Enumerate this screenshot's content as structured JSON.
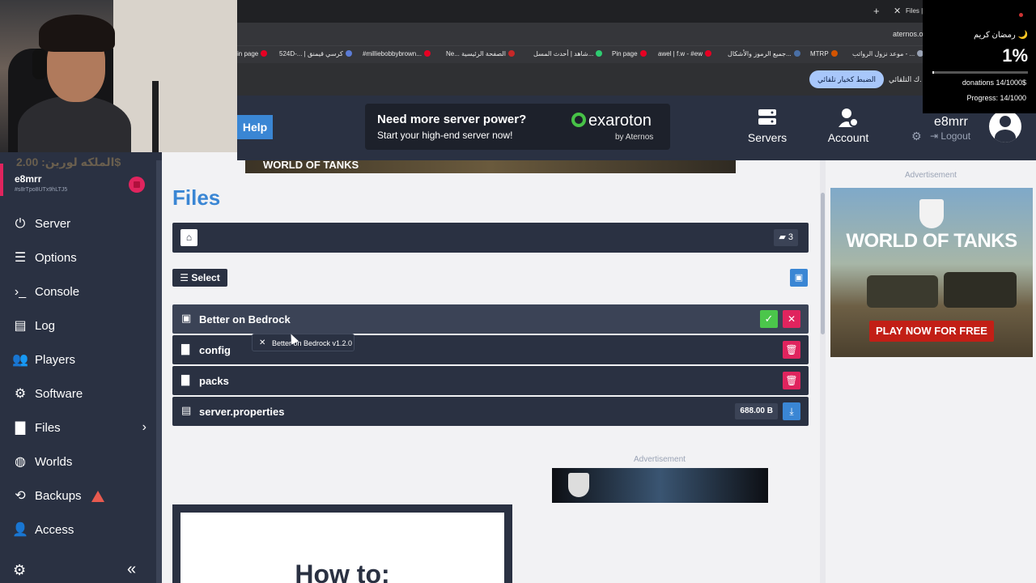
{
  "browser": {
    "tab_title": "Files |",
    "new_tab": "+",
    "close_tab": "✕",
    "url": "aternos.o",
    "bookmarks": [
      "in page",
      "524D-... | كرسي قيمنق",
      "#milliebobbybrown...",
      "Ne... الصفحة الرئيسية",
      "شاهد | أحدث المسل...",
      "Pin page",
      "awel | f.w - #ew",
      "جميع الرموز والأشكال...",
      "MTRP",
      "موعد نزول الرواتب - ..."
    ],
    "autoset_button": "الضبط كخيار تلقائي",
    "autoset_text": "ك التلقائي."
  },
  "overlay": {
    "greeting": "رمضان كريم 🌙",
    "percent": "1%",
    "progress_fraction": 0.014,
    "donations": "donations 14/1000$",
    "progress": "Progress: 14/1000"
  },
  "header": {
    "help": "Help",
    "promo_title": "Need more server power?",
    "promo_sub": "Start your high-end server now!",
    "promo_brand": "exaroton",
    "promo_brand_sub": "by Aternos",
    "nav_servers": "Servers",
    "nav_account": "Account",
    "username": "e8mrr",
    "logout": "Logout"
  },
  "sidebar": {
    "price_text": "الملكه لورين: 2.00$",
    "server_name": "e8mrr",
    "server_id": "#s8rTpo8UTx9hLTJ5",
    "items": [
      {
        "label": "Server",
        "icon": "⏻"
      },
      {
        "label": "Options",
        "icon": "☰"
      },
      {
        "label": "Console",
        "icon": "›_"
      },
      {
        "label": "Log",
        "icon": "▤"
      },
      {
        "label": "Players",
        "icon": "👥"
      },
      {
        "label": "Software",
        "icon": "⚙"
      },
      {
        "label": "Files",
        "icon": "▇"
      },
      {
        "label": "Worlds",
        "icon": "◍"
      },
      {
        "label": "Backups",
        "icon": "⟲"
      },
      {
        "label": "Access",
        "icon": "👤"
      }
    ],
    "collapse": "«"
  },
  "main": {
    "banner_text": "WORLD OF TANKS",
    "title": "Files",
    "folder_count": "3",
    "select": "Select",
    "rows": [
      {
        "name": "Better on Bedrock",
        "editing": true
      },
      {
        "name": "config"
      },
      {
        "name": "packs"
      },
      {
        "name": "server.properties",
        "size": "688.00 B"
      }
    ],
    "tooltip": "Better on Bedrock v1.2.0",
    "advertisement": "Advertisement",
    "howto": "How to:"
  },
  "right_ad": {
    "label": "Advertisement",
    "title": "WORLD OF TANKS",
    "cta": "PLAY NOW FOR FREE"
  }
}
